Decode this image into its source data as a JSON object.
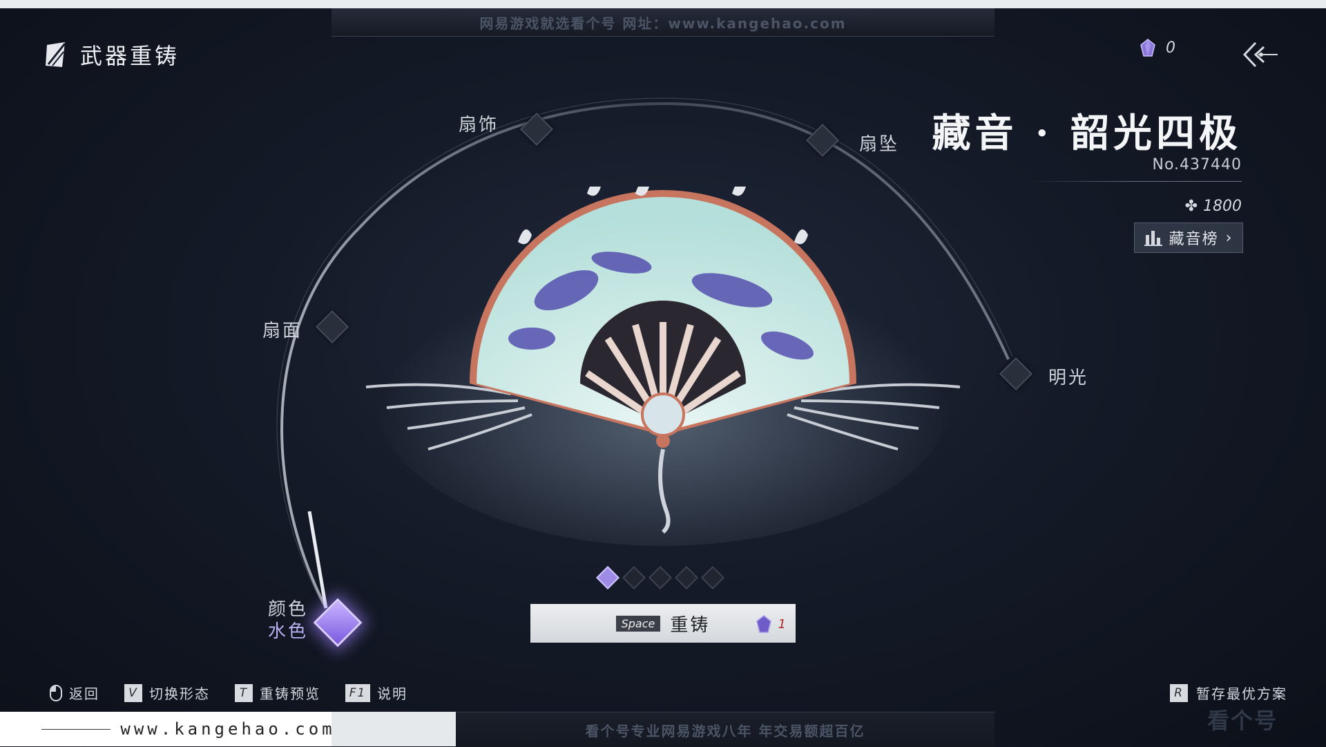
{
  "banners": {
    "top": "网易游戏就选看个号   网址：www.kangehao.com",
    "bottom": "看个号专业网易游戏八年   年交易额超百亿",
    "footer_url": "www.kangehao.com",
    "corner_watermark": "看个号"
  },
  "header": {
    "title": "武器重铸",
    "currency_value": "0"
  },
  "weapon": {
    "name": "藏音 · 韶光四极",
    "number": "No.437440",
    "score": "1800",
    "rank_button": "藏音榜",
    "rank_chevron": "›"
  },
  "slots": {
    "top_left": "扇饰",
    "top_right": "扇坠",
    "left": "扇面",
    "right": "明光",
    "color_title": "颜色",
    "color_value": "水色"
  },
  "recast": {
    "key": "Space",
    "label": "重铸",
    "cost": "1"
  },
  "hints": {
    "back": "返回",
    "switch_key": "V",
    "switch": "切换形态",
    "preview_key": "T",
    "preview": "重铸预览",
    "help_key": "F1",
    "help": "说明",
    "save_key": "R",
    "save": "暂存最优方案"
  },
  "pager": {
    "count": 5,
    "active_index": 0
  },
  "colors": {
    "accent": "#9d8be6",
    "gem": "#7a5ae0",
    "cost_red": "#b3282e",
    "fan_paper": "#bfe3df",
    "fan_cloud": "#4f4aa8"
  },
  "icons": [
    "weapon-recast-icon",
    "gem-icon",
    "back-arrow-icon",
    "bar-chart-icon",
    "mouse-icon"
  ]
}
